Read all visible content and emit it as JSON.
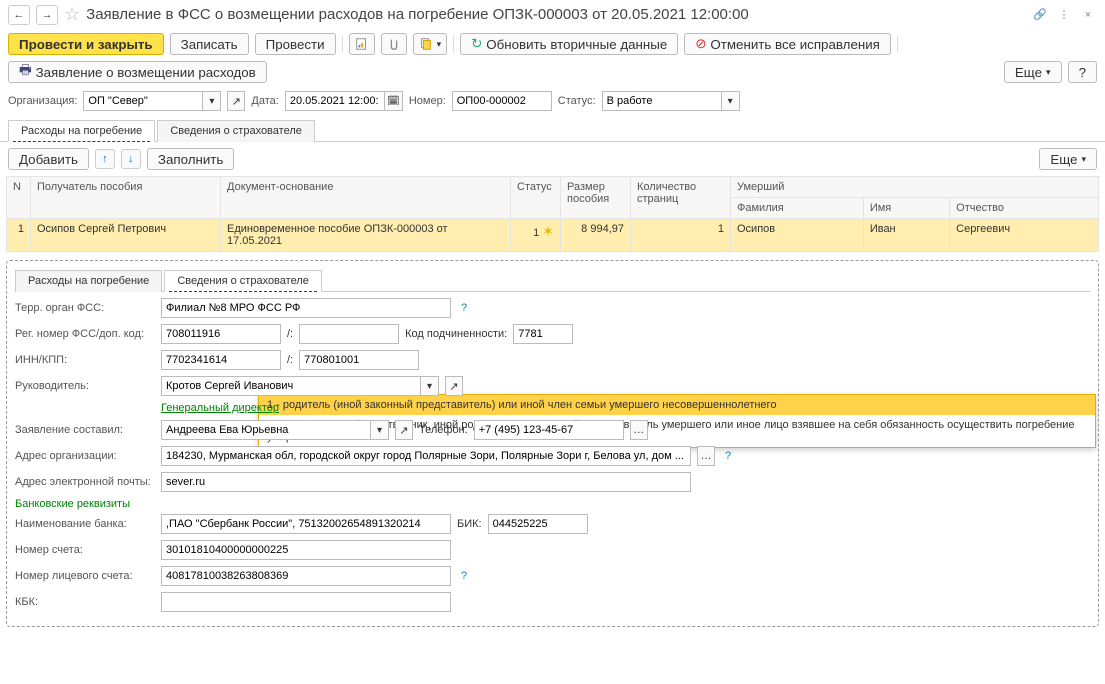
{
  "titlebar": {
    "title": "Заявление в ФСС о возмещении расходов на погребение ОПЗК-000003 от 20.05.2021 12:00:00"
  },
  "toolbar": {
    "post_close": "Провести и закрыть",
    "write": "Записать",
    "post": "Провести",
    "refresh": "Обновить вторичные данные",
    "cancel_all": "Отменить все исправления",
    "print_doc": "Заявление о возмещении расходов",
    "more": "Еще",
    "help": "?"
  },
  "header": {
    "org_label": "Организация:",
    "org_value": "ОП \"Север\"",
    "date_label": "Дата:",
    "date_value": "20.05.2021 12:00:",
    "num_label": "Номер:",
    "num_value": "ОП00-000002",
    "status_label": "Статус:",
    "status_value": "В работе"
  },
  "tabs": {
    "t1": "Расходы на погребение",
    "t2": "Сведения о страхователе"
  },
  "rowbar": {
    "add": "Добавить",
    "fill": "Заполнить",
    "more": "Еще"
  },
  "thead": {
    "n": "N",
    "recipient": "Получатель пособия",
    "doc": "Документ-основание",
    "status": "Статус",
    "amount": "Размер пособия",
    "pages": "Количество страниц",
    "deceased": "Умерший",
    "surname": "Фамилия",
    "name": "Имя",
    "patronymic": "Отчество"
  },
  "row": {
    "n": "1",
    "recipient": "Осипов Сергей Петрович",
    "doc": "Единовременное пособие ОПЗК-000003 от 17.05.2021",
    "status": "1",
    "amount": "8 994,97",
    "pages": "1",
    "surname": "Осипов",
    "name": "Иван",
    "patronymic": "Сергеевич"
  },
  "dropdown": {
    "opt1": "1 - родитель (иной законный представитель) или иной член семьи умершего несовершеннолетнего",
    "opt2": "2 - супруг, близкий родственник, иной родственник, законный представитель умершего или иное лицо взявшее на себя обязанность осуществить погребение умершего"
  },
  "sub": {
    "tab1": "Расходы на погребение",
    "tab2": "Сведения о страхователе",
    "terr_label": "Терр. орган ФСС:",
    "terr_value": "Филиал №8 МРО ФСС РФ",
    "reg_label": "Рег. номер ФСС/доп. код:",
    "reg_value": "708011916",
    "slash": "/:",
    "kod_pod_label": "Код подчиненности:",
    "kod_pod_value": "7781",
    "innkpp_label": "ИНН/КПП:",
    "inn": "7702341614",
    "kpp": "770801001",
    "head_label": "Руководитель:",
    "head_value": "Кротов Сергей Иванович",
    "head_post": "Генеральный директор",
    "author_label": "Заявление составил:",
    "author_value": "Андреева Ева Юрьевна",
    "phone_label": "Телефон:",
    "phone_value": "+7 (495) 123-45-67",
    "addr_label": "Адрес организации:",
    "addr_value": "184230, Мурманская обл, городской округ город Полярные Зори, Полярные Зори г, Белова ул, дом ...",
    "email_label": "Адрес электронной почты:",
    "email_value": "sever.ru",
    "bank_section": "Банковские реквизиты",
    "bank_label": "Наименование банка:",
    "bank_value": ",ПАО \"Сбербанк России\", 75132002654891320214",
    "bik_label": "БИК:",
    "bik_value": "044525225",
    "acct_label": "Номер счета:",
    "acct_value": "30101810400000000225",
    "pers_label": "Номер лицевого счета:",
    "pers_value": "40817810038263808369",
    "kbk_label": "КБК:"
  }
}
